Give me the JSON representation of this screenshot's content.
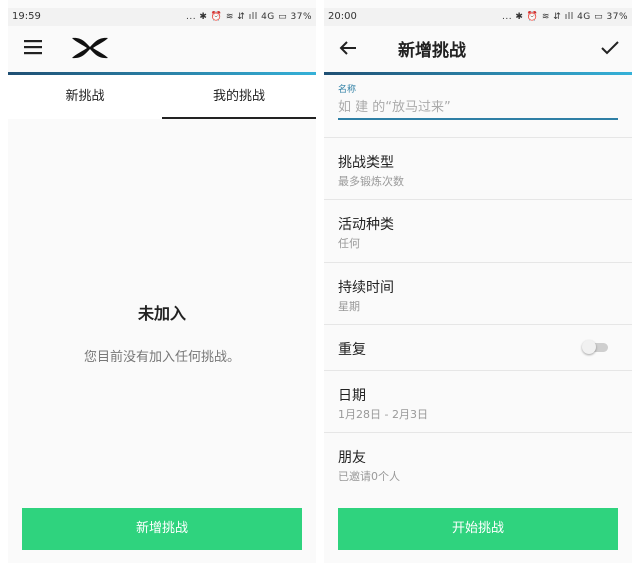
{
  "left_screen": {
    "status_bar": {
      "time": "19:59",
      "icons": "... ✱ ⏰ ≋ ⇵ ıll 4G ▭ 37%"
    },
    "tabs": [
      {
        "label": "新挑战"
      },
      {
        "label": "我的挑战",
        "active": true
      }
    ],
    "empty_state": {
      "title": "未加入",
      "message": "您目前没有加入任何挑战。"
    },
    "add_button_label": "新增挑战"
  },
  "right_screen": {
    "status_bar": {
      "time": "20:00",
      "icons": "... ✱ ⏰ ≋ ⇵ ıll 4G ▭ 37%"
    },
    "title": "新增挑战",
    "name_field": {
      "label": "名称",
      "placeholder": "如 建 的“放马过来”"
    },
    "fields": [
      {
        "label": "挑战类型",
        "value": "最多锻炼次数"
      },
      {
        "label": "活动种类",
        "value": "任何"
      },
      {
        "label": "持续时间",
        "value": "星期"
      },
      {
        "label": "重复",
        "toggle": false
      },
      {
        "label": "日期",
        "value": "1月28日 - 2月3日"
      },
      {
        "label": "朋友",
        "value": "已邀请0个人"
      }
    ],
    "start_button_label": "开始挑战"
  },
  "colors": {
    "accent_green": "#2fd37e",
    "link_blue": "#2e7fa5"
  },
  "icons": [
    "menu-icon",
    "under-armour-logo",
    "back-arrow-icon",
    "checkmark-icon"
  ]
}
